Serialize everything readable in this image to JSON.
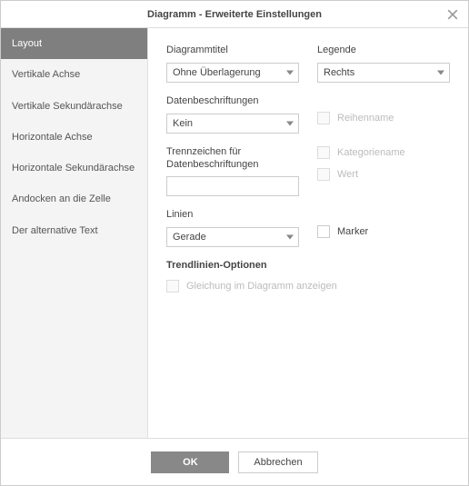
{
  "dialog": {
    "title": "Diagramm - Erweiterte Einstellungen"
  },
  "sidebar": {
    "items": [
      {
        "label": "Layout"
      },
      {
        "label": "Vertikale Achse"
      },
      {
        "label": "Vertikale Sekundärachse"
      },
      {
        "label": "Horizontale Achse"
      },
      {
        "label": "Horizontale Sekundärachse"
      },
      {
        "label": "Andocken an die Zelle"
      },
      {
        "label": "Der alternative Text"
      }
    ]
  },
  "fields": {
    "chart_title": {
      "label": "Diagrammtitel",
      "value": "Ohne Überlagerung"
    },
    "legend": {
      "label": "Legende",
      "value": "Rechts"
    },
    "data_labels": {
      "label": "Datenbeschriftungen",
      "value": "Kein"
    },
    "separator": {
      "label": "Trennzeichen für Datenbeschriftungen",
      "value": ""
    },
    "lines": {
      "label": "Linien",
      "value": "Gerade"
    },
    "checks": {
      "series_name": "Reihenname",
      "category_name": "Kategoriename",
      "value": "Wert",
      "marker": "Marker"
    },
    "trendline": {
      "title": "Trendlinien-Optionen",
      "show_equation": "Gleichung im Diagramm anzeigen"
    }
  },
  "footer": {
    "ok": "OK",
    "cancel": "Abbrechen"
  }
}
